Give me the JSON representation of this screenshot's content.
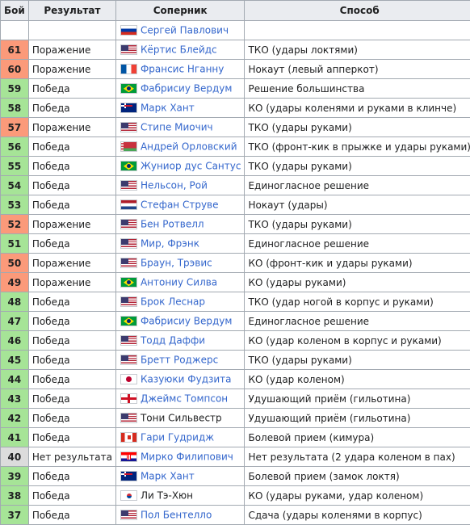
{
  "table": {
    "headers": {
      "fight": "Бой",
      "result": "Результат",
      "opponent": "Соперник",
      "method": "Способ"
    },
    "colors": {
      "win": "#a6e497",
      "loss": "#fb9a7a",
      "no_contest": "#dcdcdc",
      "link": "#3366cc"
    },
    "rows": [
      {
        "fight": "",
        "result": "",
        "opponent": "Сергей Павлович",
        "flag": "russia-flag",
        "linked": true,
        "method": "",
        "cut": "U"
      },
      {
        "fight": "61",
        "result": "Поражение",
        "opponent": "Кёртис Блейдс",
        "flag": "usa-flag",
        "linked": true,
        "method": "ТКО (удары локтями)",
        "cut": "U"
      },
      {
        "fight": "60",
        "result": "Поражение",
        "opponent": "Франсис Нганну",
        "flag": "france-flag",
        "linked": true,
        "method": "Нокаут (левый апперкот)",
        "cut": "U"
      },
      {
        "fight": "59",
        "result": "Победа",
        "opponent": "Фабрисиу Вердум",
        "flag": "brazil-flag",
        "linked": true,
        "method": "Решение большинства",
        "cut": "U"
      },
      {
        "fight": "58",
        "result": "Победа",
        "opponent": "Марк Хант",
        "flag": "new-zealand-flag",
        "linked": true,
        "method": "КО (удары коленями и руками в клинче)",
        "cut": "U"
      },
      {
        "fight": "57",
        "result": "Поражение",
        "opponent": "Стипе Миочич",
        "flag": "usa-flag",
        "linked": true,
        "method": "ТКО (удары руками)",
        "cut": "U"
      },
      {
        "fight": "56",
        "result": "Победа",
        "opponent": "Андрей Орловский",
        "flag": "belarus-flag",
        "linked": true,
        "method": "ТКО (фронт-кик в прыжке и удары руками)",
        "cut": "U"
      },
      {
        "fight": "55",
        "result": "Победа",
        "opponent": "Жуниор дус Сантус",
        "flag": "brazil-flag",
        "linked": true,
        "method": "ТКО (удары руками)",
        "cut": "U"
      },
      {
        "fight": "54",
        "result": "Победа",
        "opponent": "Нельсон, Рой",
        "flag": "usa-flag",
        "linked": true,
        "method": "Единогласное решение",
        "cut": "U"
      },
      {
        "fight": "53",
        "result": "Победа",
        "opponent": "Стефан Струве",
        "flag": "netherlands-flag",
        "linked": true,
        "method": "Нокаут (удары)",
        "cut": "U"
      },
      {
        "fight": "52",
        "result": "Поражение",
        "opponent": "Бен Ротвелл",
        "flag": "usa-flag",
        "linked": true,
        "method": "ТКО (удары руками)",
        "cut": "U"
      },
      {
        "fight": "51",
        "result": "Победа",
        "opponent": "Мир, Фрэнк",
        "flag": "usa-flag",
        "linked": true,
        "method": "Единогласное решение",
        "cut": "U"
      },
      {
        "fight": "50",
        "result": "Поражение",
        "opponent": "Браун, Трэвис",
        "flag": "usa-flag",
        "linked": true,
        "method": "КО (фронт-кик и удары руками)",
        "cut": "U"
      },
      {
        "fight": "49",
        "result": "Поражение",
        "opponent": "Антониу Силва",
        "flag": "brazil-flag",
        "linked": true,
        "method": "КО (удары руками)",
        "cut": "U"
      },
      {
        "fight": "48",
        "result": "Победа",
        "opponent": "Брок Леснар",
        "flag": "usa-flag",
        "linked": true,
        "method": "ТКО (удар ногой в корпус и руками)",
        "cut": "U"
      },
      {
        "fight": "47",
        "result": "Победа",
        "opponent": "Фабрисиу Вердум",
        "flag": "brazil-flag",
        "linked": true,
        "method": "Единогласное решение",
        "cut": "S"
      },
      {
        "fight": "46",
        "result": "Победа",
        "opponent": "Тодд Даффи",
        "flag": "usa-flag",
        "linked": true,
        "method": "КО (удар коленом в корпус и руками)",
        "cut": "U"
      },
      {
        "fight": "45",
        "result": "Победа",
        "opponent": "Бретт Роджерс",
        "flag": "usa-flag",
        "linked": true,
        "method": "ТКО (удары руками)",
        "cut": "S"
      },
      {
        "fight": "44",
        "result": "Победа",
        "opponent": "Казуюки Фудзита",
        "flag": "japan-flag",
        "linked": true,
        "method": "КО (удар коленом)",
        "cut": "D"
      },
      {
        "fight": "43",
        "result": "Победа",
        "opponent": "Джеймс Томпсон",
        "flag": "england-flag",
        "linked": true,
        "method": "Удушающий приём (гильотина)",
        "cut": "D"
      },
      {
        "fight": "42",
        "result": "Победа",
        "opponent": "Тони Сильвестр",
        "flag": "usa-flag",
        "linked": false,
        "method": "Удушающий приём (гильотина)",
        "cut": "D"
      },
      {
        "fight": "41",
        "result": "Победа",
        "opponent": "Гари Гудридж",
        "flag": "canada-flag",
        "linked": true,
        "method": "Болевой прием (кимура)",
        "cut": "D"
      },
      {
        "fight": "40",
        "result": "Нет результата",
        "opponent": "Мирко Филипович",
        "flag": "croatia-flag",
        "linked": true,
        "method": "Нет результата (2 удара коленом в пах)",
        "cut": "D"
      },
      {
        "fight": "39",
        "result": "Победа",
        "opponent": "Марк Хант",
        "flag": "new-zealand-flag",
        "linked": true,
        "method": "Болевой прием (замок локтя)",
        "cut": "D"
      },
      {
        "fight": "38",
        "result": "Победа",
        "opponent": "Ли Тэ-Хюн",
        "flag": "south-korea-flag",
        "linked": false,
        "method": "КО (удары руками, удар коленом)",
        "cut": "D"
      },
      {
        "fight": "37",
        "result": "Победа",
        "opponent": "Пол Бентелло",
        "flag": "usa-flag",
        "linked": true,
        "method": "Сдача (удары коленями в корпус)",
        "cut": "D"
      }
    ]
  }
}
